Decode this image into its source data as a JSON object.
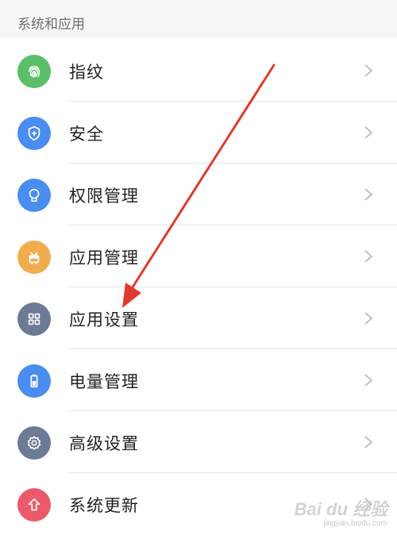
{
  "section": {
    "title": "系统和应用"
  },
  "items": [
    {
      "label": "指纹",
      "icon": "fingerprint-icon",
      "color": "#5bbf6a"
    },
    {
      "label": "安全",
      "icon": "shield-icon",
      "color": "#4a8df0"
    },
    {
      "label": "权限管理",
      "icon": "badge-icon",
      "color": "#4a8df0"
    },
    {
      "label": "应用管理",
      "icon": "android-icon",
      "color": "#f0ad4e"
    },
    {
      "label": "应用设置",
      "icon": "grid-icon",
      "color": "#6c7a96"
    },
    {
      "label": "电量管理",
      "icon": "battery-icon",
      "color": "#4a8df0"
    },
    {
      "label": "高级设置",
      "icon": "gear-icon",
      "color": "#6c7a96"
    },
    {
      "label": "系统更新",
      "icon": "arrow-up-icon",
      "color": "#ea5a6a"
    }
  ],
  "annotation": {
    "arrow_color": "#e03a2e"
  },
  "watermark": {
    "logo": "Bai du 经验",
    "url": "jingyan.baidu.com"
  }
}
